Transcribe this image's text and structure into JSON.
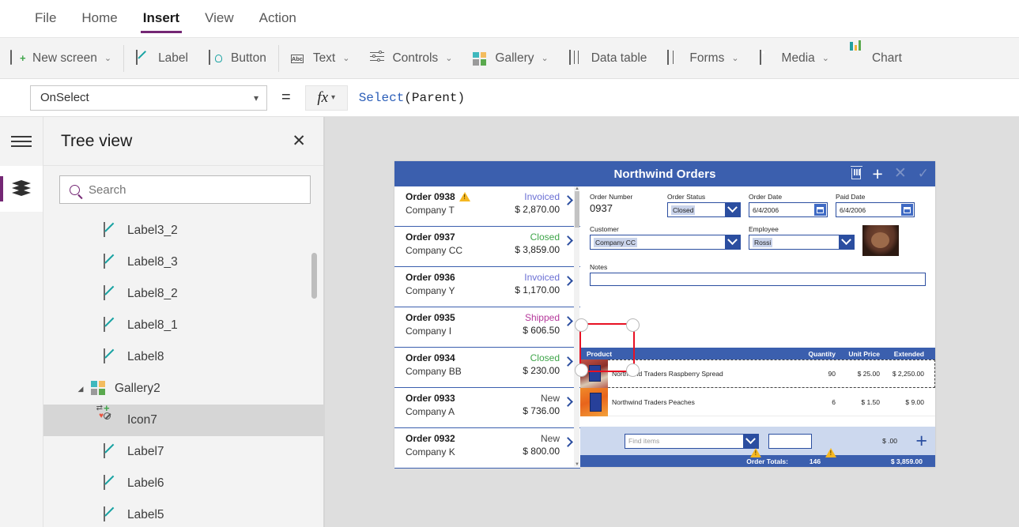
{
  "menu": {
    "items": [
      {
        "label": "File",
        "active": false
      },
      {
        "label": "Home",
        "active": false
      },
      {
        "label": "Insert",
        "active": true
      },
      {
        "label": "View",
        "active": false
      },
      {
        "label": "Action",
        "active": false
      }
    ],
    "accent_color": "#742774"
  },
  "ribbon": {
    "items": [
      {
        "label": "New screen",
        "icon": "new-screen-icon",
        "chevron": "⌄"
      },
      {
        "label": "Label",
        "icon": "label-pen-icon",
        "chevron": ""
      },
      {
        "label": "Button",
        "icon": "button-icon",
        "chevron": ""
      },
      {
        "label": "Text",
        "icon": "text-abc-icon",
        "chevron": "⌄"
      },
      {
        "label": "Controls",
        "icon": "controls-sliders-icon",
        "chevron": "⌄"
      },
      {
        "label": "Gallery",
        "icon": "gallery-icon",
        "chevron": "⌄"
      },
      {
        "label": "Data table",
        "icon": "data-table-icon",
        "chevron": ""
      },
      {
        "label": "Forms",
        "icon": "forms-icon",
        "chevron": "⌄"
      },
      {
        "label": "Media",
        "icon": "media-icon",
        "chevron": "⌄"
      },
      {
        "label": "Chart",
        "icon": "chart-icon",
        "chevron": ""
      }
    ]
  },
  "formula_bar": {
    "property": "OnSelect",
    "equals": "=",
    "fx_label": "fx",
    "fx_chevron": "⌄",
    "formula_fn": "Select",
    "formula_rest": "(Parent)"
  },
  "rail": {
    "hamburger": "hamburger-menu-icon",
    "tree_view_button": "layers-icon"
  },
  "tree": {
    "title": "Tree view",
    "close": "✕",
    "search_placeholder": "Search",
    "search_value": "",
    "nodes": [
      {
        "label": "Label3_2",
        "icon": "label-icon",
        "indent": 2,
        "caret": "",
        "selected": false
      },
      {
        "label": "Label8_3",
        "icon": "label-icon",
        "indent": 2,
        "caret": "",
        "selected": false
      },
      {
        "label": "Label8_2",
        "icon": "label-icon",
        "indent": 2,
        "caret": "",
        "selected": false
      },
      {
        "label": "Label8_1",
        "icon": "label-icon",
        "indent": 2,
        "caret": "",
        "selected": false
      },
      {
        "label": "Label8",
        "icon": "label-icon",
        "indent": 2,
        "caret": "",
        "selected": false
      },
      {
        "label": "Gallery2",
        "icon": "gallery-icon",
        "indent": 1,
        "caret": "◢",
        "selected": false
      },
      {
        "label": "Icon7",
        "icon": "icon-collection-icon",
        "indent": 3,
        "caret": "",
        "selected": true
      },
      {
        "label": "Label7",
        "icon": "label-icon",
        "indent": 3,
        "caret": "",
        "selected": false
      },
      {
        "label": "Label6",
        "icon": "label-icon",
        "indent": 3,
        "caret": "",
        "selected": false
      },
      {
        "label": "Label5",
        "icon": "label-icon",
        "indent": 3,
        "caret": "",
        "selected": false
      }
    ]
  },
  "app": {
    "title": "Northwind Orders",
    "header_icons": [
      {
        "name": "delete-icon",
        "glyph": "trash"
      },
      {
        "name": "add-icon",
        "glyph": "plus"
      },
      {
        "name": "cancel-icon",
        "glyph": "x"
      },
      {
        "name": "save-icon",
        "glyph": "check"
      }
    ],
    "orders": [
      {
        "number": "Order 0938",
        "company": "Company T",
        "status": "Invoiced",
        "amount": "$ 2,870.00",
        "warning": true
      },
      {
        "number": "Order 0937",
        "company": "Company CC",
        "status": "Closed",
        "amount": "$ 3,859.00",
        "warning": false
      },
      {
        "number": "Order 0936",
        "company": "Company Y",
        "status": "Invoiced",
        "amount": "$ 1,170.00",
        "warning": false
      },
      {
        "number": "Order 0935",
        "company": "Company I",
        "status": "Shipped",
        "amount": "$ 606.50",
        "warning": false
      },
      {
        "number": "Order 0934",
        "company": "Company BB",
        "status": "Closed",
        "amount": "$ 230.00",
        "warning": false
      },
      {
        "number": "Order 0933",
        "company": "Company A",
        "status": "New",
        "amount": "$ 736.00",
        "warning": false
      },
      {
        "number": "Order 0932",
        "company": "Company K",
        "status": "New",
        "amount": "$ 800.00",
        "warning": false
      }
    ],
    "form": {
      "order_number_label": "Order Number",
      "order_number_value": "0937",
      "order_status_label": "Order Status",
      "order_status_value": "Closed",
      "order_date_label": "Order Date",
      "order_date_value": "6/4/2006",
      "paid_date_label": "Paid Date",
      "paid_date_value": "6/4/2006",
      "customer_label": "Customer",
      "customer_value": "Company CC",
      "employee_label": "Employee",
      "employee_value": "Rossi",
      "notes_label": "Notes",
      "notes_value": ""
    },
    "products": {
      "headers": {
        "product": "Product",
        "quantity": "Quantity",
        "unit_price": "Unit Price",
        "extended": "Extended"
      },
      "rows": [
        {
          "name": "Northwind Traders Raspberry Spread",
          "quantity": "90",
          "unit_price": "$ 25.00",
          "extended": "$ 2,250.00",
          "selected": true
        },
        {
          "name": "Northwind Traders Peaches",
          "quantity": "6",
          "unit_price": "$ 1.50",
          "extended": "$ 9.00",
          "selected": false
        }
      ],
      "add_row": {
        "find_placeholder": "Find items",
        "quantity_value": "",
        "amount": "$ .00",
        "plus": "+"
      },
      "totals": {
        "label": "Order Totals:",
        "quantity": "146",
        "amount": "$ 3,859.00"
      }
    }
  },
  "colors": {
    "accent_purple": "#742774",
    "app_blue": "#3b5fae",
    "field_border_blue": "#2b4ea0",
    "selection_red": "#e81123",
    "canvas_bg": "#dedede",
    "status_invoiced": "#6a6fd4",
    "status_closed": "#3fa54a",
    "status_shipped": "#b5399b",
    "status_new": "#444444"
  }
}
